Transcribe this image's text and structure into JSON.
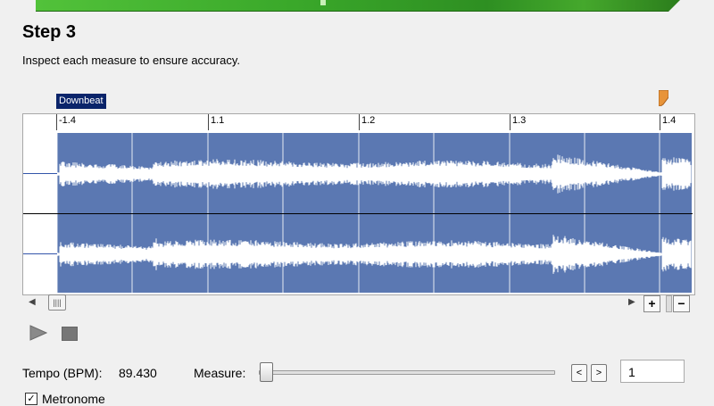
{
  "step": {
    "title": "Step 3",
    "description": "Inspect each measure to ensure accuracy."
  },
  "waveform": {
    "downbeat_label": "Downbeat",
    "ruler_labels": [
      "-1.4",
      "1.1",
      "1.2",
      "1.3",
      "1.4"
    ],
    "colors": {
      "wave_bg": "#5b78b2",
      "wave_fg": "#ffffff",
      "tag_bg": "#0a246a",
      "marker": "#e8943a"
    },
    "icons": [
      "marker-flag-icon",
      "scroll-left-icon",
      "scroll-right-icon",
      "scroll-thumb-grip-icon"
    ]
  },
  "zoom": {
    "in_label": "+",
    "out_label": "−"
  },
  "transport": {
    "icons": [
      "play-icon",
      "stop-icon"
    ]
  },
  "tempo": {
    "label": "Tempo (BPM):",
    "value": "89.430"
  },
  "measure": {
    "label": "Measure:",
    "prev_label": "<",
    "next_label": ">",
    "value": "1",
    "slider_fraction": 0.0
  },
  "metronome": {
    "label": "Metronome",
    "checked": true,
    "check_glyph": "✓"
  }
}
